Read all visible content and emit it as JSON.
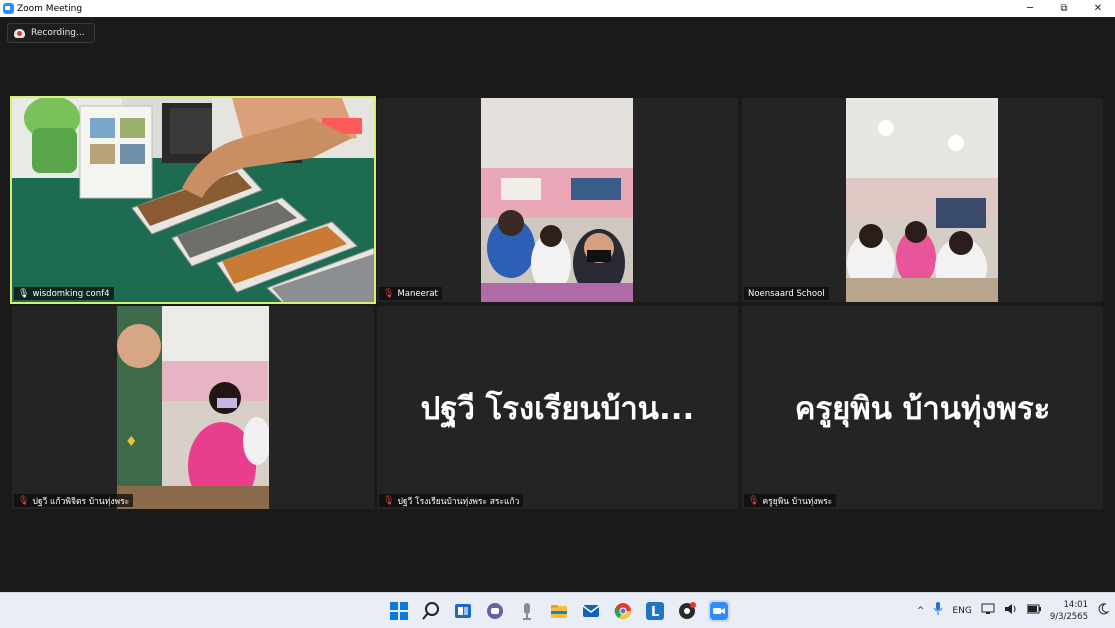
{
  "window": {
    "title": "Zoom Meeting",
    "minimize": "─",
    "restore": "⧉",
    "close": "✕"
  },
  "recording": {
    "label": "Recording..."
  },
  "participants": [
    {
      "name": "wisdomking conf4",
      "muted": false,
      "active": true
    },
    {
      "name": "Maneerat",
      "muted": true,
      "active": false
    },
    {
      "name": "Noensaard School",
      "muted": false,
      "active": false
    },
    {
      "name": "ปฐวี แก้วพิจิตร บ้านทุ่งพระ",
      "muted": true,
      "active": false
    },
    {
      "name": "ปฐวี โรงเรียนบ้านทุ่งพระ สระแก้ว",
      "display": "ปฐวี โรงเรียนบ้าน...",
      "muted": true,
      "active": false
    },
    {
      "name": "ครูยุพิน บ้านทุ่งพระ",
      "display": "ครูยุพิน บ้านทุ่งพระ",
      "muted": true,
      "active": false
    }
  ],
  "taskbar": {
    "apps": [
      "windows-start-icon",
      "search-icon",
      "task-view-icon",
      "teams-chat-icon",
      "microphone-app-icon",
      "file-explorer-icon",
      "mail-icon",
      "chrome-icon",
      "line-icon",
      "obs-icon",
      "zoom-icon"
    ],
    "line_letter": "L",
    "tray": {
      "chevron": "^",
      "language": "ENG",
      "time": "14:01",
      "date": "9/3/2565"
    }
  },
  "colors": {
    "active_outline": "#d8f070",
    "muted_red": "#e04040",
    "zoom_blue": "#2d8cff"
  }
}
